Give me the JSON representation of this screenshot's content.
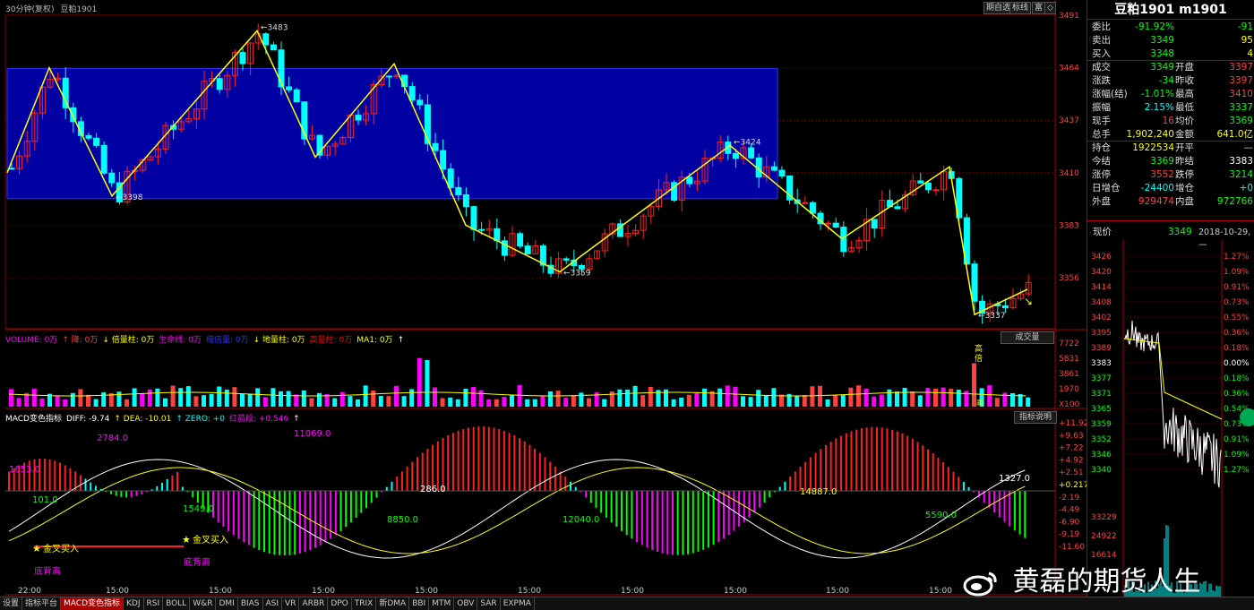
{
  "header": {
    "timeframe": "30分钟(复权)",
    "symbol": "豆粕1901",
    "buttons": [
      "期自选",
      "标线",
      "富",
      "◇"
    ]
  },
  "price_axis": {
    "labels": [
      "3491",
      "3464",
      "3437",
      "3410",
      "3383",
      "3356"
    ]
  },
  "zigzag_labels": [
    "3483",
    "3398",
    "3359",
    "3424",
    "3337"
  ],
  "volume_header": [
    {
      "text": "VOLUME: 0万",
      "color": "#ff00ff"
    },
    {
      "text": "↑ 降: 0万",
      "color": "#ff4040"
    },
    {
      "text": "↓ 倍量柱: 0万",
      "color": "#ffff00"
    },
    {
      "text": "生命线: 0万",
      "color": "#ff00ff"
    },
    {
      "text": "缩倍量: 0万",
      "color": "#3030ff"
    },
    {
      "text": "↓ 地量柱: 0万",
      "color": "#ffff00"
    },
    {
      "text": "高量柱: 0万",
      "color": "#ff0000"
    },
    {
      "text": "MA1: 0万",
      "color": "#ffff00"
    },
    {
      "text": "↑",
      "color": "#ffffff"
    }
  ],
  "volume_axis": {
    "labels": [
      "7722",
      "5831",
      "3861",
      "1970",
      "X100"
    ],
    "button": "成交量"
  },
  "vol_markers": {
    "gao": "高",
    "bei": "倍",
    "gao2": "高"
  },
  "macd_header": [
    {
      "text": "MACD变色指标",
      "color": "#ffffff"
    },
    {
      "text": "DIFF: -9.74",
      "color": "#ffffff"
    },
    {
      "text": "↑ DEA: -10.01",
      "color": "#ffff00"
    },
    {
      "text": "↑ ZERO: +0",
      "color": "#00ffff"
    },
    {
      "text": "红箭段: +0.546",
      "color": "#ff00ff"
    },
    {
      "text": "↑",
      "color": "#ffffff"
    }
  ],
  "macd_axis": {
    "labels": [
      "+11.92",
      "+9.63",
      "+7.22",
      "+4.92",
      "+2.51",
      "+0.217",
      "-2.19",
      "-4.49",
      "-6.90",
      "-9.19",
      "-11.60"
    ],
    "button": "指标说明"
  },
  "macd_labels": {
    "a": "1653.0",
    "b": "2784.0",
    "c": "11069.0",
    "d": "101.0",
    "e": "1549.0",
    "f": "286.0",
    "g": "8850.0",
    "h": "12040.0",
    "i": "14887.0",
    "j": "1327.0",
    "k": "5590.0"
  },
  "signals": {
    "gold1": "金叉买入",
    "gold2": "金叉买入",
    "bot1": "底背离",
    "bot2": "底背离"
  },
  "time_axis": [
    "22:00",
    "15:00",
    "15:00",
    "15:00",
    "15:00",
    "15:00",
    "15:00",
    "15:00",
    "15:00",
    "15:00"
  ],
  "quote": {
    "title": "豆粕1901 m1901",
    "rows": [
      {
        "l": "委比",
        "v": "-91.92%",
        "vc": "#00ff00",
        "l2": "",
        "v2": "-91",
        "v2c": "#00ff00"
      },
      {
        "l": "卖出",
        "v": "3349",
        "vc": "#00ff00",
        "l2": "",
        "v2": "95",
        "v2c": "#ffff00"
      },
      {
        "l": "买入",
        "v": "3348",
        "vc": "#00ff00",
        "l2": "",
        "v2": "4",
        "v2c": "#ffff00"
      },
      {
        "l": "成交",
        "v": "3349",
        "vc": "#00ff00",
        "l2": "开盘",
        "v2": "3397",
        "v2c": "#ff4040"
      },
      {
        "l": "涨跌",
        "v": "-34",
        "vc": "#00ff00",
        "l2": "昨收",
        "v2": "3397",
        "v2c": "#ff4040"
      },
      {
        "l": "涨幅(结)",
        "v": "-1.01%",
        "vc": "#00ff00",
        "l2": "最高",
        "v2": "3410",
        "v2c": "#ff4040"
      },
      {
        "l": "振幅",
        "v": "2.15%",
        "vc": "#00ffff",
        "l2": "最低",
        "v2": "3337",
        "v2c": "#00ff00"
      },
      {
        "l": "现手",
        "v": "16",
        "vc": "#ff4040",
        "l2": "均价",
        "v2": "3369",
        "v2c": "#00ff00"
      },
      {
        "l": "总手",
        "v": "1,902,240",
        "vc": "#ffff00",
        "l2": "金额",
        "v2": "641.0亿",
        "v2c": "#ffff00"
      },
      {
        "l": "持仓",
        "v": "1922534",
        "vc": "#ffff00",
        "l2": "开平",
        "v2": "—",
        "v2c": "#c0c0c0"
      },
      {
        "l": "今结",
        "v": "3369",
        "vc": "#00ff00",
        "l2": "昨结",
        "v2": "3383",
        "v2c": "#ffffff"
      },
      {
        "l": "涨停",
        "v": "3552",
        "vc": "#ff4040",
        "l2": "跌停",
        "v2": "3214",
        "v2c": "#00ff00"
      },
      {
        "l": "日增仓",
        "v": "-24400",
        "vc": "#00ffff",
        "l2": "增仓",
        "v2": "+0",
        "v2c": "#00ffff"
      },
      {
        "l": "外盘",
        "v": "929474",
        "vc": "#ff4040",
        "l2": "内盘",
        "v2": "972766",
        "v2c": "#00ff00"
      }
    ],
    "now_label": "现价",
    "now_value": "3349",
    "date": "2018-10-29,一"
  },
  "mini": {
    "left": [
      "3426",
      "3420",
      "3414",
      "3408",
      "3402",
      "3395",
      "3389",
      "3383",
      "3377",
      "3371",
      "3365",
      "3359",
      "3352",
      "3346",
      "3340"
    ],
    "right": [
      "1.27%",
      "1.09%",
      "0.91%",
      "0.73%",
      "0.55%",
      "0.36%",
      "0.18%",
      "0.00%",
      "0.18%",
      "0.36%",
      "0.54%",
      "0.73%",
      "0.91%",
      "1.09%",
      "1.27%"
    ],
    "vol": [
      "33229",
      "24922",
      "16614"
    ]
  },
  "tabs": [
    "设置",
    "指标平台",
    "MACD变色指标",
    "KDJ",
    "RSI",
    "BOLL",
    "W&R",
    "DMI",
    "BIAS",
    "ASI",
    "VR",
    "ARBR",
    "DPO",
    "TRIX",
    "新DMA",
    "BBI",
    "MTM",
    "OBV",
    "SAR",
    "EXPMA"
  ],
  "active_tab": "MACD变色指标",
  "watermark": "黄磊的期货人生",
  "colors": {
    "up": "#ff2020",
    "down": "#00ffff",
    "zigzag": "#ffff00",
    "box": "#0000c0",
    "grid": "#800000"
  }
}
